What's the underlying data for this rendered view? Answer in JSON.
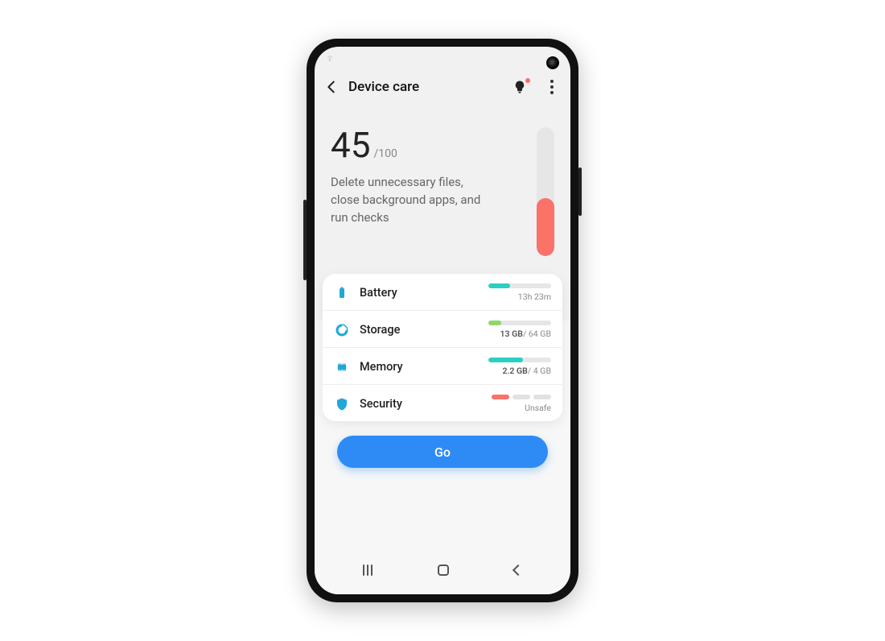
{
  "header": {
    "title": "Device care"
  },
  "score": {
    "value": "45",
    "max": "/100",
    "message": "Delete unnecessary files, close background apps, and run checks",
    "fill_percent": 45,
    "fill_color": "#fa7268"
  },
  "rows": {
    "battery": {
      "label": "Battery",
      "value": "13h 23m",
      "fill_percent": 34,
      "fill_color": "#2bd0c3"
    },
    "storage": {
      "label": "Storage",
      "used": "13 GB",
      "total": "/ 64 GB",
      "fill_percent": 20,
      "fill_color": "#8fd66b"
    },
    "memory": {
      "label": "Memory",
      "used": "2.2 GB",
      "total": "/ 4 GB",
      "fill_percent": 55,
      "fill_color": "#2bd0c3"
    },
    "security": {
      "label": "Security",
      "status": "Unsafe",
      "seg_color": "#fa7268"
    }
  },
  "action": {
    "go": "Go"
  },
  "colors": {
    "accent": "#2e8bf5",
    "teal": "#2bd0c3",
    "green": "#8fd66b",
    "red": "#fa7268",
    "icon_blue": "#1fa8d8"
  }
}
